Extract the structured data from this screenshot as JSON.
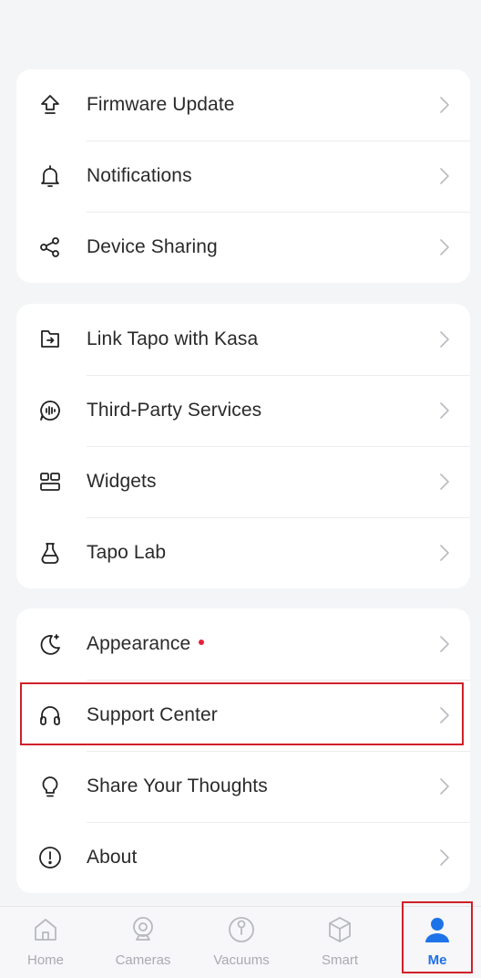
{
  "groups": [
    {
      "items": [
        {
          "label": "Firmware Update",
          "icon": "firmware-update-icon"
        },
        {
          "label": "Notifications",
          "icon": "bell-icon"
        },
        {
          "label": "Device Sharing",
          "icon": "share-icon"
        }
      ]
    },
    {
      "items": [
        {
          "label": "Link Tapo with Kasa",
          "icon": "link-icon"
        },
        {
          "label": "Third-Party Services",
          "icon": "voice-assistant-icon"
        },
        {
          "label": "Widgets",
          "icon": "widgets-icon"
        },
        {
          "label": "Tapo Lab",
          "icon": "flask-icon"
        }
      ]
    },
    {
      "items": [
        {
          "label": "Appearance",
          "icon": "moon-icon",
          "badge": true
        },
        {
          "label": "Support Center",
          "icon": "headset-icon",
          "highlighted": true
        },
        {
          "label": "Share Your Thoughts",
          "icon": "lightbulb-icon"
        },
        {
          "label": "About",
          "icon": "info-icon"
        }
      ]
    }
  ],
  "tabs": [
    {
      "label": "Home",
      "icon": "home-icon",
      "active": false
    },
    {
      "label": "Cameras",
      "icon": "camera-icon",
      "active": false
    },
    {
      "label": "Vacuums",
      "icon": "vacuum-icon",
      "active": false
    },
    {
      "label": "Smart",
      "icon": "cube-icon",
      "active": false
    },
    {
      "label": "Me",
      "icon": "person-icon",
      "active": true
    }
  ],
  "colors": {
    "accent": "#1f73e8",
    "badge": "#e8203a",
    "highlight_border": "#d0202a",
    "background": "#f4f5f7"
  }
}
